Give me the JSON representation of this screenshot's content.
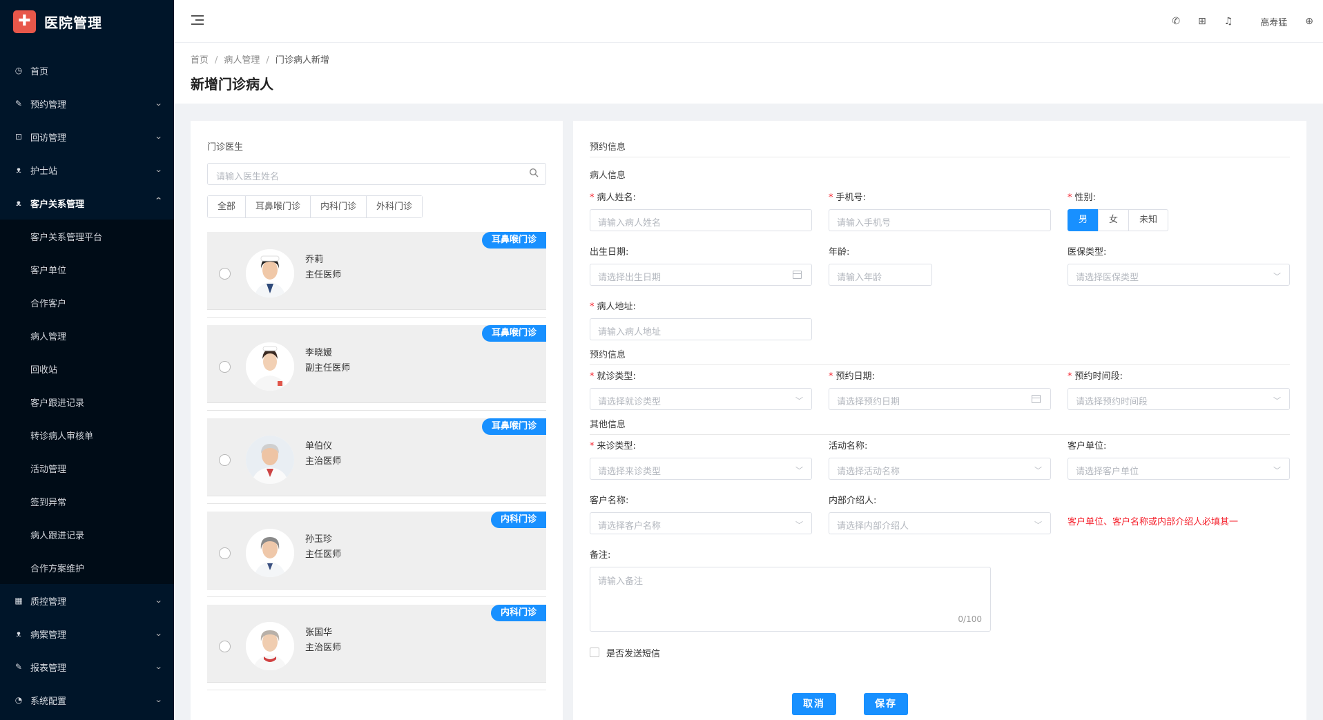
{
  "app": {
    "title": "医院管理"
  },
  "sidebar": {
    "items": [
      {
        "label": "首页",
        "icon": "dashboard-icon"
      },
      {
        "label": "预约管理",
        "icon": "edit-icon"
      },
      {
        "label": "回访管理",
        "icon": "lock-icon"
      },
      {
        "label": "护士站",
        "icon": "user-icon"
      },
      {
        "label": "客户关系管理",
        "icon": "user-icon"
      }
    ],
    "sub_items": [
      "客户关系管理平台",
      "客户单位",
      "合作客户",
      "病人管理",
      "回收站",
      "客户跟进记录",
      "转诊病人审核单",
      "活动管理",
      "签到异常",
      "病人跟进记录",
      "合作方案维护"
    ],
    "items_after": [
      {
        "label": "质控管理",
        "icon": "table-icon"
      },
      {
        "label": "病案管理",
        "icon": "user-icon"
      },
      {
        "label": "报表管理",
        "icon": "edit-icon"
      },
      {
        "label": "系统配置",
        "icon": "gauge-icon"
      }
    ]
  },
  "topbar": {
    "user": "高寿猛"
  },
  "breadcrumb": {
    "items": [
      "首页",
      "病人管理",
      "门诊病人新增"
    ],
    "sep": "/"
  },
  "page": {
    "title": "新增门诊病人"
  },
  "doctor_panel": {
    "label": "门诊医生",
    "search_placeholder": "请输入医生姓名",
    "tabs": [
      "全部",
      "耳鼻喉门诊",
      "内科门诊",
      "外科门诊"
    ],
    "doctors": [
      {
        "name": "乔莉",
        "title": "主任医师",
        "dept": "耳鼻喉门诊"
      },
      {
        "name": "李晓媛",
        "title": "副主任医师",
        "dept": "耳鼻喉门诊"
      },
      {
        "name": "单伯仪",
        "title": "主治医师",
        "dept": "耳鼻喉门诊"
      },
      {
        "name": "孙玉珍",
        "title": "主任医师",
        "dept": "内科门诊"
      },
      {
        "name": "张国华",
        "title": "主治医师",
        "dept": "内科门诊"
      }
    ]
  },
  "form": {
    "section_top": "预约信息",
    "section_patient": "病人信息",
    "section_appt": "预约信息",
    "section_other": "其他信息",
    "name": {
      "label": "病人姓名:",
      "placeholder": "请输入病人姓名"
    },
    "phone": {
      "label": "手机号:",
      "placeholder": "请输入手机号"
    },
    "gender": {
      "label": "性别:",
      "options": [
        "男",
        "女",
        "未知"
      ],
      "selected": "男"
    },
    "birth": {
      "label": "出生日期:",
      "placeholder": "请选择出生日期"
    },
    "age": {
      "label": "年龄:",
      "placeholder": "请输入年龄"
    },
    "insurance": {
      "label": "医保类型:",
      "placeholder": "请选择医保类型"
    },
    "address": {
      "label": "病人地址:",
      "placeholder": "请输入病人地址"
    },
    "visit_type": {
      "label": "就诊类型:",
      "placeholder": "请选择就诊类型"
    },
    "appt_date": {
      "label": "预约日期:",
      "placeholder": "请选择预约日期"
    },
    "appt_time": {
      "label": "预约时间段:",
      "placeholder": "请选择预约时间段"
    },
    "source_type": {
      "label": "来诊类型:",
      "placeholder": "请选择来诊类型"
    },
    "activity": {
      "label": "活动名称:",
      "placeholder": "请选择活动名称"
    },
    "client_unit": {
      "label": "客户单位:",
      "placeholder": "请选择客户单位"
    },
    "client_name": {
      "label": "客户名称:",
      "placeholder": "请选择客户名称"
    },
    "referrer": {
      "label": "内部介绍人:",
      "placeholder": "请选择内部介绍人"
    },
    "warning": "客户单位、客户名称或内部介绍人必填其一",
    "remark": {
      "label": "备注:",
      "placeholder": "请输入备注",
      "count": "0/100"
    },
    "sms": {
      "label": "是否发送短信"
    },
    "cancel": "取消",
    "save": "保存"
  },
  "colors": {
    "primary": "#1890ff",
    "sidebar": "#001529",
    "required": "#f5222d"
  }
}
